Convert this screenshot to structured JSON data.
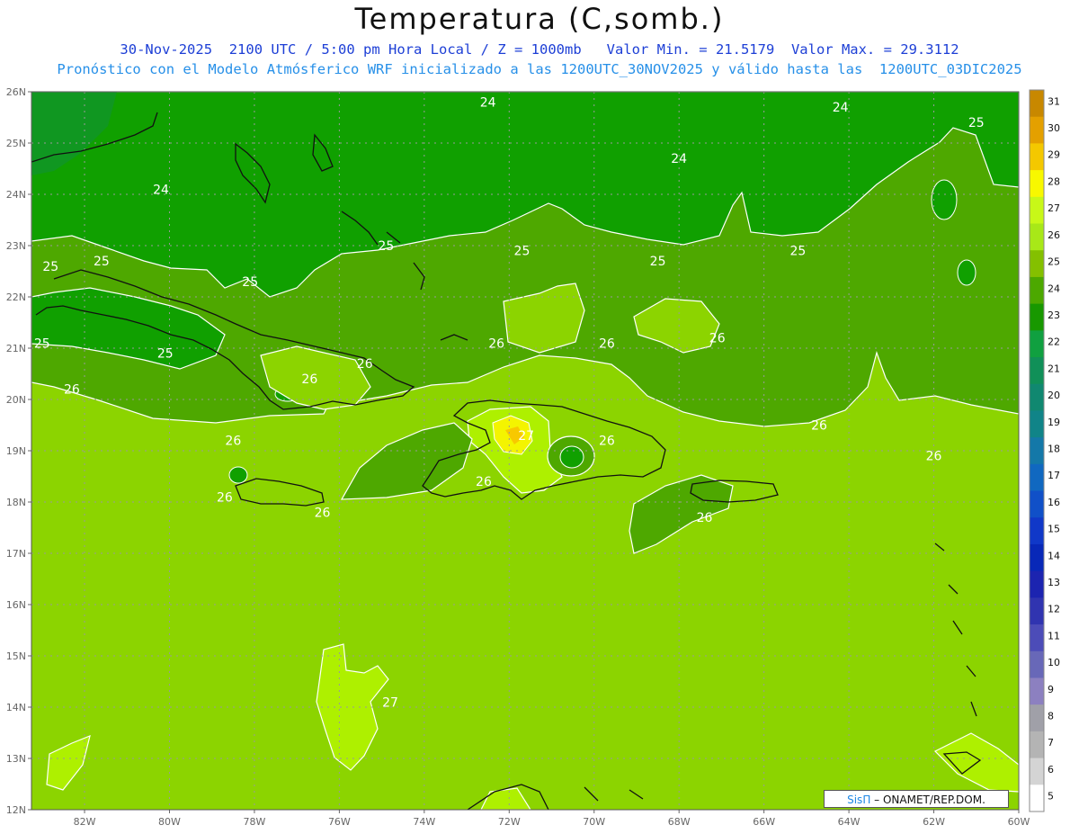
{
  "title": "Temperatura (C,somb.)",
  "subtitle_line1": "30-Nov-2025  2100 UTC / 5:00 pm Hora Local / Z = 1000mb   Valor Min. = 21.5179  Valor Max. = 29.3112",
  "subtitle_line2": "Pronóstico con el Modelo Atmósferico WRF inicializado a las 1200UTC_30NOV2025 y válido hasta las  1200UTC_03DIC2025",
  "map": {
    "lat_labels": [
      "26N",
      "25N",
      "24N",
      "23N",
      "22N",
      "21N",
      "20N",
      "19N",
      "18N",
      "17N",
      "16N",
      "15N",
      "14N",
      "13N",
      "12N"
    ],
    "lon_labels": [
      "82W",
      "80W",
      "78W",
      "76W",
      "74W",
      "72W",
      "70W",
      "68W",
      "66W",
      "64W",
      "62W",
      "60W"
    ],
    "contour_labels": [
      {
        "text": "24",
        "lon": -72.5,
        "lat": 25.8
      },
      {
        "text": "24",
        "lon": -68.0,
        "lat": 24.7
      },
      {
        "text": "24",
        "lon": -64.2,
        "lat": 25.7
      },
      {
        "text": "25",
        "lon": -61.0,
        "lat": 25.4
      },
      {
        "text": "24",
        "lon": -80.2,
        "lat": 24.1
      },
      {
        "text": "25",
        "lon": -82.8,
        "lat": 22.6
      },
      {
        "text": "25",
        "lon": -81.6,
        "lat": 22.7
      },
      {
        "text": "25",
        "lon": -74.9,
        "lat": 23.0
      },
      {
        "text": "25",
        "lon": -71.7,
        "lat": 22.9
      },
      {
        "text": "25",
        "lon": -68.5,
        "lat": 22.7
      },
      {
        "text": "25",
        "lon": -65.2,
        "lat": 22.9
      },
      {
        "text": "25",
        "lon": -78.1,
        "lat": 22.3
      },
      {
        "text": "25",
        "lon": -83.0,
        "lat": 21.1
      },
      {
        "text": "25",
        "lon": -80.1,
        "lat": 20.9
      },
      {
        "text": "26",
        "lon": -72.3,
        "lat": 21.1
      },
      {
        "text": "26",
        "lon": -69.7,
        "lat": 21.1
      },
      {
        "text": "26",
        "lon": -67.1,
        "lat": 21.2
      },
      {
        "text": "26",
        "lon": -75.4,
        "lat": 20.7
      },
      {
        "text": "26",
        "lon": -76.7,
        "lat": 20.4
      },
      {
        "text": "26",
        "lon": -82.3,
        "lat": 20.2
      },
      {
        "text": "26",
        "lon": -78.5,
        "lat": 19.2
      },
      {
        "text": "27",
        "lon": -71.6,
        "lat": 19.3
      },
      {
        "text": "26",
        "lon": -69.7,
        "lat": 19.2
      },
      {
        "text": "26",
        "lon": -64.7,
        "lat": 19.5
      },
      {
        "text": "26",
        "lon": -62.0,
        "lat": 18.9
      },
      {
        "text": "26",
        "lon": -72.6,
        "lat": 18.4
      },
      {
        "text": "26",
        "lon": -78.7,
        "lat": 18.1
      },
      {
        "text": "26",
        "lon": -76.4,
        "lat": 17.8
      },
      {
        "text": "26",
        "lon": -67.4,
        "lat": 17.7
      },
      {
        "text": "27",
        "lon": -74.8,
        "lat": 14.1
      }
    ]
  },
  "colorbar": {
    "labels": [
      "31",
      "30",
      "29",
      "28",
      "27",
      "26",
      "25",
      "24",
      "23",
      "22",
      "21",
      "20",
      "19",
      "18",
      "17",
      "16",
      "15",
      "14",
      "13",
      "12",
      "11",
      "10",
      "9",
      "8",
      "7",
      "6",
      "5"
    ],
    "colors": [
      "#c88800",
      "#e4a000",
      "#f4c800",
      "#f8f800",
      "#c8f818",
      "#a8e818",
      "#84c000",
      "#4ca800",
      "#189800",
      "#10a040",
      "#109058",
      "#108870",
      "#108488",
      "#1478a8",
      "#1068c0",
      "#1050c8",
      "#1038c8",
      "#0828b8",
      "#1c24b0",
      "#3034b0",
      "#4c4cb8",
      "#6868b8",
      "#8c80c0",
      "#a0a0a8",
      "#b4b4b4",
      "#d4d4d4",
      "#ffffff"
    ]
  },
  "credit": {
    "brand": "SisΠ",
    "sep": " – ",
    "org": "ONAMET/REP.DOM."
  },
  "field_colors": {
    "t24": "#10a000",
    "t25": "#4ea800",
    "t26": "#8cd400",
    "t27": "#aef000",
    "t28": "#f4f400",
    "t29": "#f8c800",
    "coast": "#111111"
  }
}
